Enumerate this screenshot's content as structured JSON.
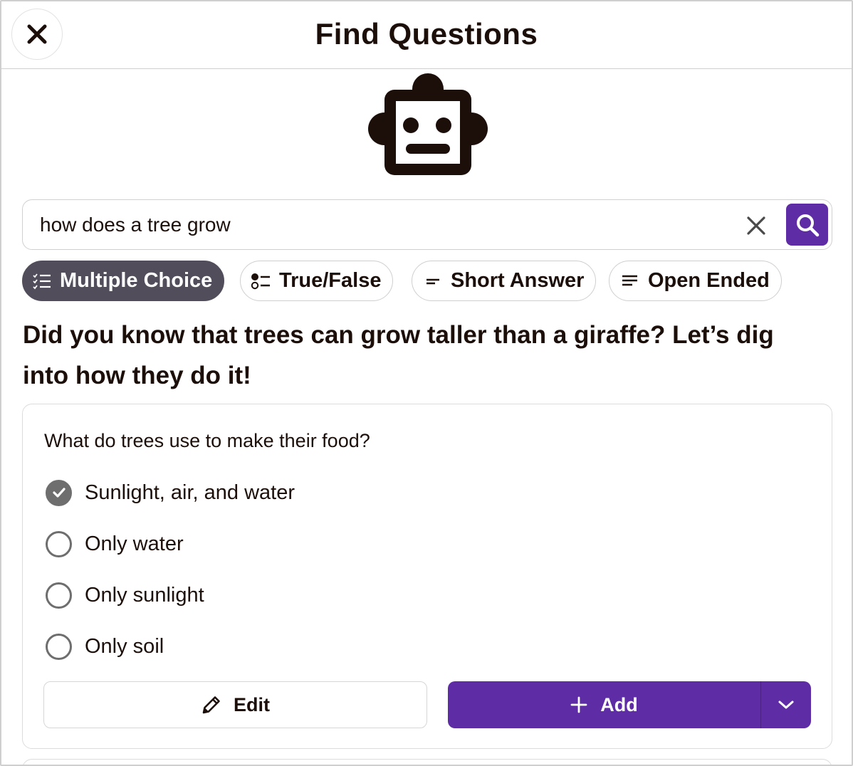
{
  "header": {
    "title": "Find Questions",
    "close_icon": "close-icon"
  },
  "mascot": {
    "icon": "robot-icon"
  },
  "search": {
    "value": "how does a tree grow",
    "clear_icon": "clear-icon",
    "search_icon": "search-icon"
  },
  "filters": [
    {
      "label": "Multiple Choice",
      "icon": "checklist-icon",
      "active": true
    },
    {
      "label": "True/False",
      "icon": "true-false-icon",
      "active": false
    },
    {
      "label": "Short Answer",
      "icon": "short-lines-icon",
      "active": false
    },
    {
      "label": "Open Ended",
      "icon": "long-lines-icon",
      "active": false
    }
  ],
  "intro": "Did you know that trees can grow taller than a giraffe? Let’s dig into how they do it!",
  "question_card": {
    "question": "What do trees use to make their food?",
    "options": [
      {
        "label": "Sunlight, air, and water",
        "correct": true
      },
      {
        "label": "Only water",
        "correct": false
      },
      {
        "label": "Only sunlight",
        "correct": false
      },
      {
        "label": "Only soil",
        "correct": false
      }
    ],
    "edit_label": "Edit",
    "add_label": "Add"
  },
  "colors": {
    "accent": "#5e2ca5",
    "active_chip": "#524d5b",
    "text": "#1c0f0a"
  }
}
